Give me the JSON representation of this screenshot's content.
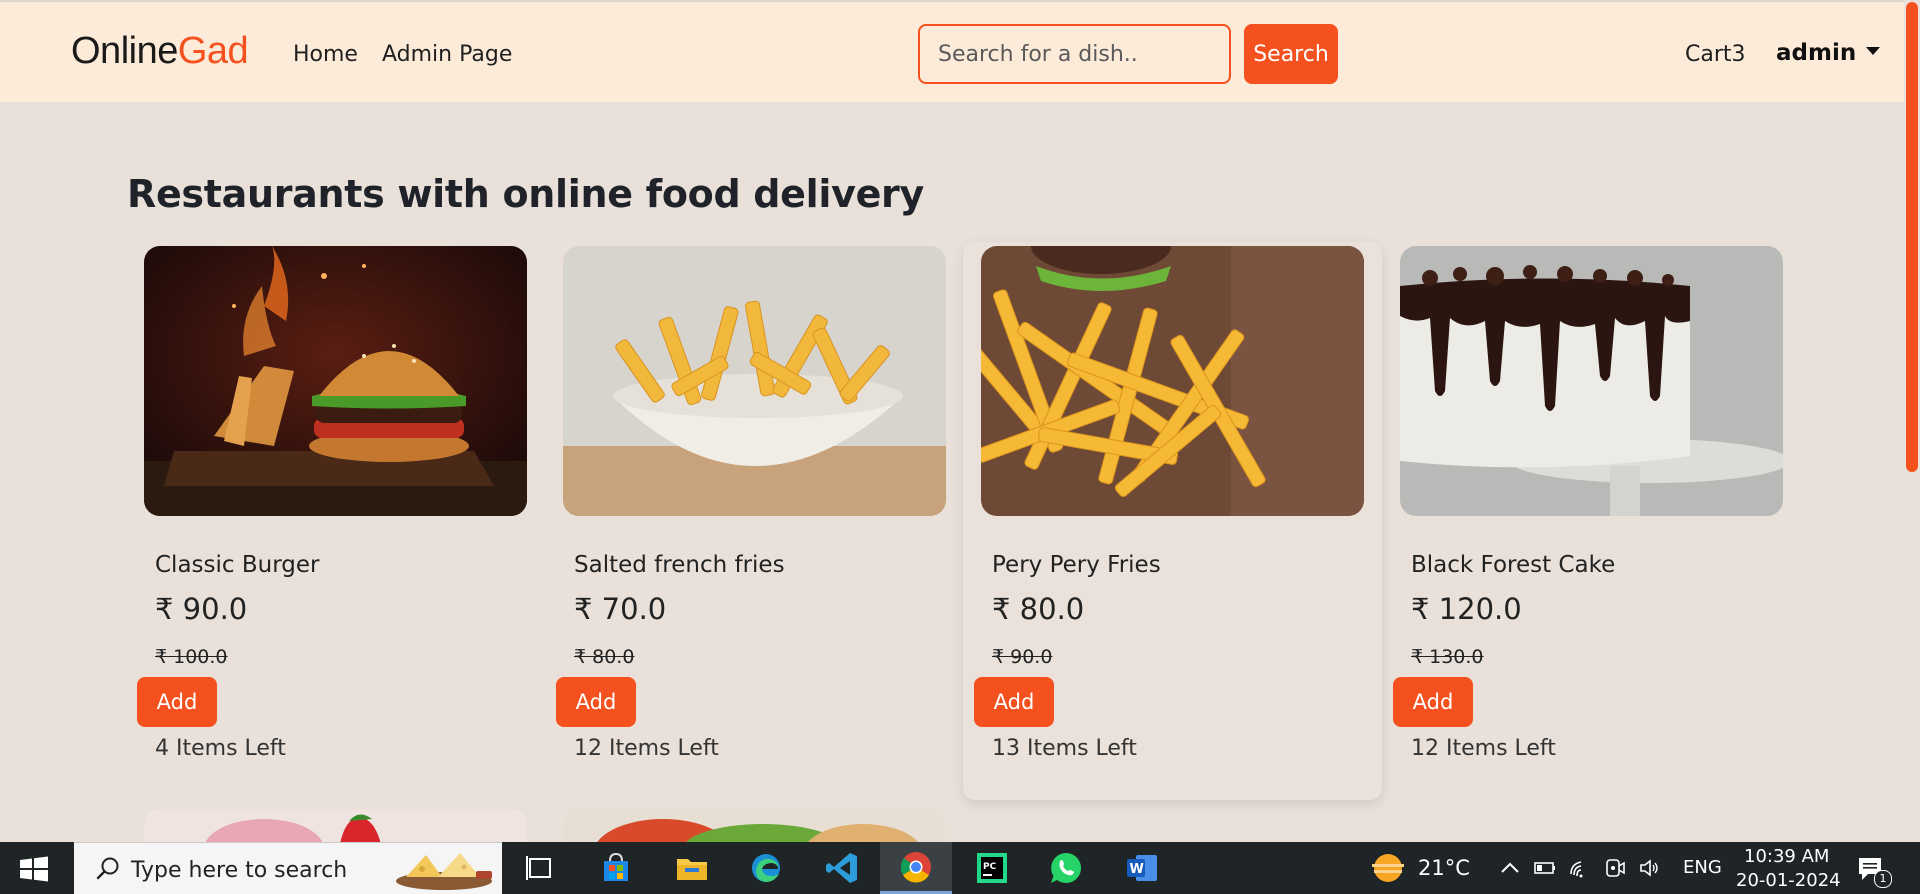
{
  "navbar": {
    "brand_part1": "Online",
    "brand_part2": "Gad",
    "links": [
      "Home",
      "Admin Page"
    ],
    "search_placeholder": "Search for a dish..",
    "search_button": "Search",
    "cart_label": "Cart3",
    "user_label": "admin"
  },
  "main": {
    "section_title": "Restaurants with online food delivery",
    "dishes": [
      {
        "name": "Classic Burger",
        "price": "₹ 90.0",
        "old_price": "₹ 100.0",
        "add_label": "Add",
        "stock": "4 Items Left"
      },
      {
        "name": "Salted french fries",
        "price": "₹ 70.0",
        "old_price": "₹ 80.0",
        "add_label": "Add",
        "stock": "12 Items Left"
      },
      {
        "name": "Pery Pery Fries",
        "price": "₹ 80.0",
        "old_price": "₹ 90.0",
        "add_label": "Add",
        "stock": "13 Items Left"
      },
      {
        "name": "Black Forest Cake",
        "price": "₹ 120.0",
        "old_price": "₹ 130.0",
        "add_label": "Add",
        "stock": "12 Items Left"
      }
    ]
  },
  "taskbar": {
    "search_text": "Type here to search",
    "pinned_icons": [
      "task-view-icon",
      "microsoft-store-icon",
      "file-explorer-icon",
      "edge-icon",
      "vscode-icon",
      "chrome-icon",
      "pycharm-icon",
      "whatsapp-icon",
      "word-icon"
    ],
    "weather": "21°C",
    "language": "ENG",
    "time": "10:39 AM",
    "date": "20-01-2024",
    "notification_count": "1"
  },
  "colors": {
    "accent": "#f4511e",
    "navbar_bg": "#fdebd9",
    "page_bg": "#e8e0d9",
    "taskbar_bg": "#1f2427"
  }
}
